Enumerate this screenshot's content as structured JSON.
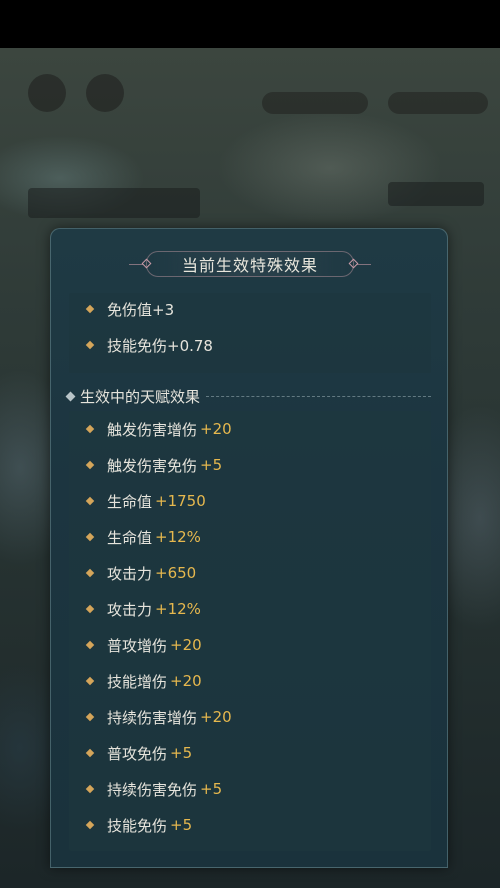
{
  "panel": {
    "title": "当前生效特殊效果",
    "special_effects": [
      {
        "name": "免伤值+3"
      },
      {
        "name": "技能免伤+0.78"
      }
    ],
    "talent_section_title": "生效中的天赋效果",
    "talent_effects": [
      {
        "name": "触发伤害增伤",
        "value": "+20"
      },
      {
        "name": "触发伤害免伤",
        "value": "+5"
      },
      {
        "name": "生命值",
        "value": "+1750"
      },
      {
        "name": "生命值",
        "value": "+12%"
      },
      {
        "name": "攻击力",
        "value": "+650"
      },
      {
        "name": "攻击力",
        "value": "+12%"
      },
      {
        "name": "普攻增伤",
        "value": "+20"
      },
      {
        "name": "技能增伤",
        "value": "+20"
      },
      {
        "name": "持续伤害增伤",
        "value": "+20"
      },
      {
        "name": "普攻免伤",
        "value": "+5"
      },
      {
        "name": "持续伤害免伤",
        "value": "+5"
      },
      {
        "name": "技能免伤",
        "value": "+5"
      }
    ]
  },
  "colors": {
    "value_gold": "#e6b84e",
    "bullet": "#d4a55a",
    "panel_bg": "#1c3540"
  },
  "icons": {
    "bullet": "diamond-bullet-icon",
    "section": "diamond-section-icon"
  }
}
